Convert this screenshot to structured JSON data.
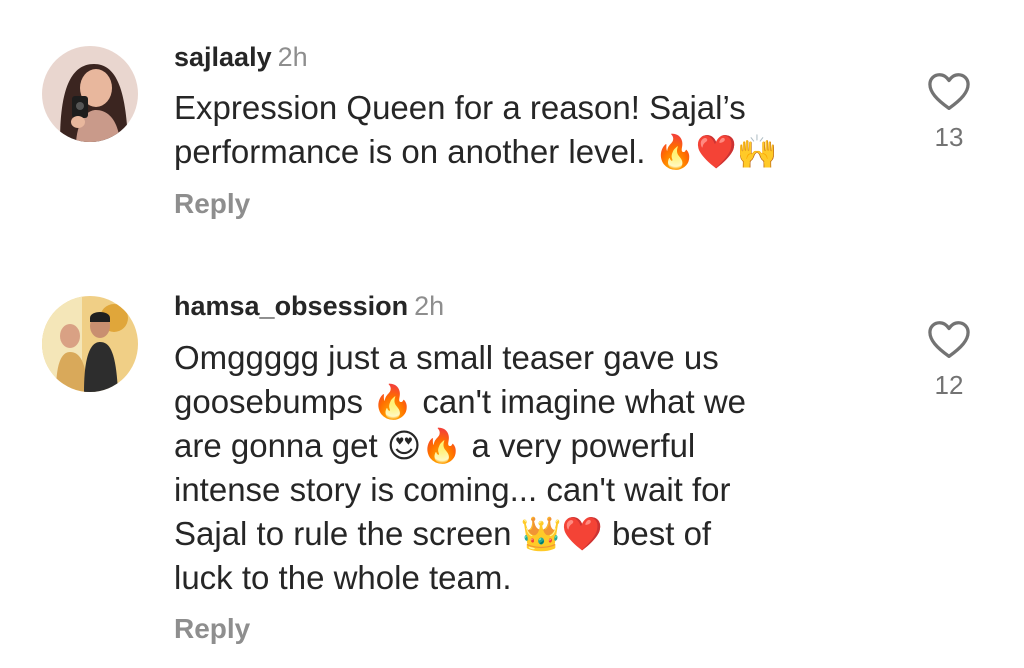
{
  "comments": [
    {
      "username": "sajlaaly",
      "time": "2h",
      "lines": [
        "Expression Queen for a reason! Sajal’s",
        "performance is on another level. 🔥❤️🙌"
      ],
      "reply": "Reply",
      "likes": "13"
    },
    {
      "username": "hamsa_obsession",
      "time": "2h",
      "lines": [
        "Omggggg just a small teaser gave us",
        "goosebumps 🔥 can't imagine what we",
        "are gonna get 😍🔥 a very powerful",
        "intense story is coming... can't wait for",
        "Sajal to rule the screen 👑❤️ best of",
        "luck to the whole team."
      ],
      "reply": "Reply",
      "likes": "12"
    }
  ],
  "icons": {
    "like": "heart-outline-icon"
  },
  "colors": {
    "text": "#262626",
    "muted": "#8e8e8e",
    "count": "#737373"
  }
}
